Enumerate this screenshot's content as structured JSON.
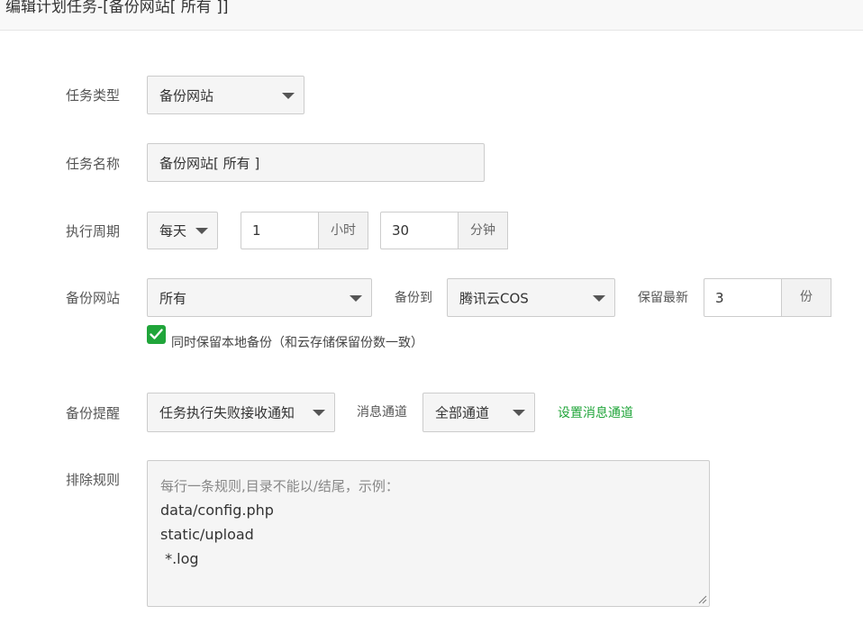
{
  "title": "编辑计划任务-[备份网站[ 所有 ]]",
  "task_type": {
    "label": "任务类型",
    "value": "备份网站"
  },
  "task_name": {
    "label": "任务名称",
    "value": "备份网站[ 所有 ]"
  },
  "period": {
    "label": "执行周期",
    "mode": "每天",
    "hour": "1",
    "hour_unit": "小时",
    "minute": "30",
    "minute_unit": "分钟"
  },
  "backup_site": {
    "label": "备份网站",
    "value": "所有",
    "dest_label": "备份到",
    "dest_value": "腾讯云COS",
    "keep_label": "保留最新",
    "keep_value": "3",
    "keep_unit": "份"
  },
  "keep_local": {
    "checked": true,
    "label": "同时保留本地备份（和云存储保留份数一致）"
  },
  "notify": {
    "label": "备份提醒",
    "value": "任务执行失败接收通知",
    "channel_label": "消息通道",
    "channel_value": "全部通道",
    "setup_link": "设置消息通道"
  },
  "exclude": {
    "label": "排除规则",
    "placeholder": "每行一条规则,目录不能以/结尾，示例：",
    "lines": [
      "data/config.php",
      "static/upload",
      " *.log"
    ]
  },
  "colors": {
    "accent": "#20a53a",
    "border": "#cccccc",
    "field_bg": "#f5f5f5"
  }
}
